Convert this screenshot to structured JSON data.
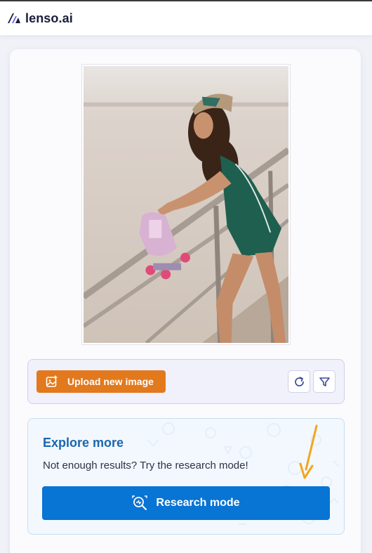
{
  "header": {
    "logo_text": "lenso.ai",
    "logo_icon": "lenso-logo-icon"
  },
  "image_preview": {
    "alt": "Woman with roller skates leaning on a railing"
  },
  "toolbar": {
    "upload_label": "Upload new image",
    "upload_icon": "image-plus-icon",
    "refresh_icon": "refresh-icon",
    "filter_icon": "filter-icon"
  },
  "explore": {
    "title": "Explore more",
    "text": "Not enough results? Try the research mode!",
    "button_label": "Research mode",
    "button_icon": "magnify-scan-icon"
  },
  "colors": {
    "brand_dark": "#1b1d3a",
    "upload_orange": "#e2791d",
    "primary_blue": "#0874d4",
    "title_blue": "#1c66ae",
    "annotation_arrow": "#f3a51c"
  }
}
